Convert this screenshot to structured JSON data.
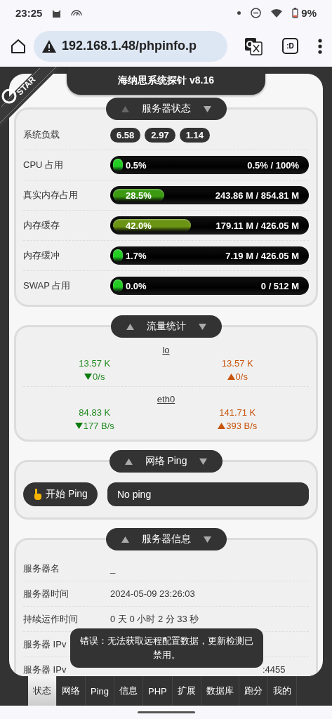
{
  "status_bar": {
    "time": "23:25",
    "battery": "9%"
  },
  "browser": {
    "url": "192.168.1.48/phpinfo.p",
    "tab_switcher": ":D"
  },
  "ribbon": {
    "label": "STAR"
  },
  "title": "海纳思系统探针 v8.16",
  "server_status": {
    "legend": "服务器状态",
    "load": {
      "label": "系统负载",
      "values": [
        "6.58",
        "2.97",
        "1.14"
      ]
    },
    "meters": [
      {
        "label": "CPU 占用",
        "percent": "0.5%",
        "reading": "0.5% / 100%",
        "level": 0.005,
        "color": "#22cc22"
      },
      {
        "label": "真实内存占用",
        "percent": "28.5%",
        "reading": "243.86 M / 854.81 M",
        "level": 0.285,
        "color": "#3c9a12"
      },
      {
        "label": "内存缓存",
        "percent": "42.0%",
        "reading": "179.11 M / 426.05 M",
        "level": 0.42,
        "color": "#6b9414"
      },
      {
        "label": "内存缓冲",
        "percent": "1.7%",
        "reading": "7.19 M / 426.05 M",
        "level": 0.017,
        "color": "#22cc22"
      },
      {
        "label": "SWAP 占用",
        "percent": "0.0%",
        "reading": "0 / 512 M",
        "level": 0.0,
        "color": "#22cc22"
      }
    ]
  },
  "traffic": {
    "legend": "流量统计",
    "interfaces": [
      {
        "name": "lo",
        "in_total": "13.57 K",
        "in_rate": "0/s",
        "out_total": "13.57 K",
        "out_rate": "0/s"
      },
      {
        "name": "eth0",
        "in_total": "84.83 K",
        "in_rate": "177 B/s",
        "out_total": "141.71 K",
        "out_rate": "393 B/s"
      }
    ]
  },
  "ping": {
    "legend": "网络 Ping",
    "button": "开始 Ping",
    "result": "No ping"
  },
  "server_info": {
    "legend": "服务器信息",
    "rows": [
      {
        "label": "服务器名",
        "value": "_"
      },
      {
        "label": "服务器时间",
        "value": "2024-05-09 23:26:03"
      },
      {
        "label": "持续运作时间",
        "value": "0 天 0 小时 2 分 33 秒"
      },
      {
        "label": "服务器 IPv"
      },
      {
        "label": "服务器 IPv",
        "value": ":4455",
        "covered": true
      }
    ]
  },
  "toast": "错误：无法获取远程配置数据，更新检测已禁用。",
  "nav": [
    {
      "label": "状态",
      "selected": true
    },
    {
      "label": "网络",
      "selected": false
    },
    {
      "label": "Ping",
      "selected": false
    },
    {
      "label": "信息",
      "selected": false
    },
    {
      "label": "PHP",
      "selected": false
    },
    {
      "label": "扩展",
      "selected": false
    },
    {
      "label": "数据库",
      "selected": false
    },
    {
      "label": "跑分",
      "selected": false
    },
    {
      "label": "我的",
      "selected": false
    }
  ]
}
